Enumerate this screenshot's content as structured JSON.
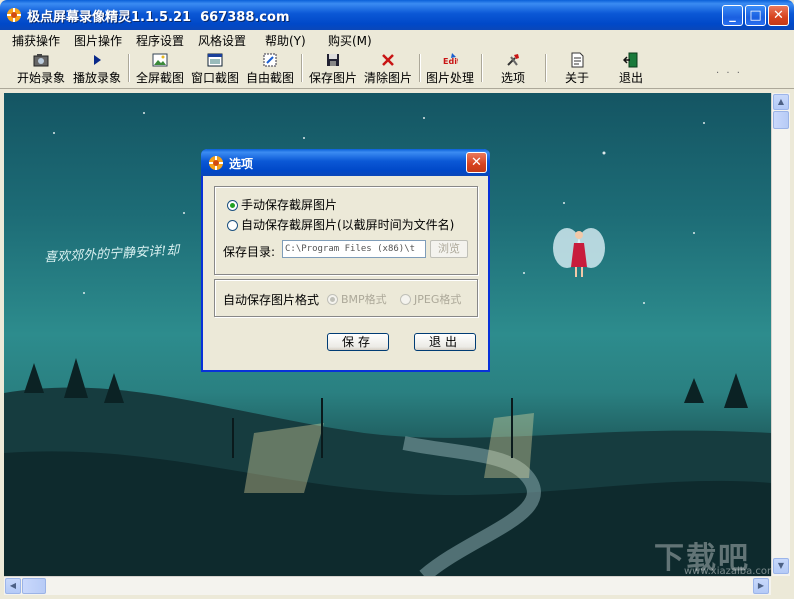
{
  "window": {
    "title": "极点屏幕录像精灵1.1.5.21  667388.com",
    "min": "_",
    "max": "□",
    "close": "✕"
  },
  "menu": [
    "捕获操作",
    "图片操作",
    "程序设置",
    "风格设置",
    "帮助(Y)",
    "购买(M)"
  ],
  "toolbar": {
    "start_record": "开始录象",
    "play_record": "播放录象",
    "fullscreen": "全屏截图",
    "window_capture": "窗口截图",
    "free_capture": "自由截图",
    "save_image": "保存图片",
    "clear_image": "清除图片",
    "image_process": "图片处理",
    "options": "选项",
    "about": "关于",
    "exit": "退出",
    "more": "· · ·"
  },
  "scene": {
    "text": "喜欢郊外的宁静安详!却",
    "watermark": "下载吧",
    "watermark_sub": "www.xiazaiba.com"
  },
  "dialog": {
    "title": "选项",
    "close": "✕",
    "radio_manual": "手动保存截屏图片",
    "radio_auto": "自动保存截屏图片(以截屏时间为文件名)",
    "save_dir_label": "保存目录:",
    "save_dir_value": "C:\\Program Files (x86)\\t",
    "browse": "浏览",
    "format_label": "自动保存图片格式",
    "bmp": "BMP格式",
    "jpeg": "JPEG格式",
    "save_btn": "保存",
    "exit_btn": "退出",
    "manual_selected": true,
    "bmp_selected": true
  },
  "colors": {
    "titlebar": "#0b58d6",
    "window_bg": "#ece9d8",
    "scene_top": "#145563",
    "scene_mid": "#2d8c8d"
  }
}
